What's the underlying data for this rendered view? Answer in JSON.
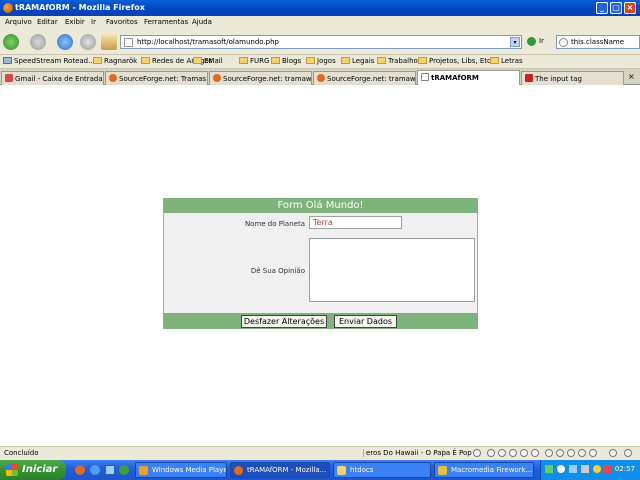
{
  "window": {
    "title": "tRAMAfORM - Mozilla Firefox",
    "controls": {
      "minimize": "_",
      "maximize": "□",
      "close": "×"
    }
  },
  "menu": [
    "Arquivo",
    "Editar",
    "Exibir",
    "Ir",
    "Favoritos",
    "Ferramentas",
    "Ajuda"
  ],
  "navbar": {
    "url": "http://localhost/tramasoft/olamundo.php",
    "go_label": "Ir",
    "search_value": "this.className",
    "dropdown_glyph": "▾"
  },
  "bookmarks": [
    "SpeedStream Rotead...",
    "Ragnarök",
    "Redes de Amigos",
    "EMail",
    "FURG",
    "Blogs",
    "Jogos",
    "Legais",
    "Trabalho",
    "Projetos, Libs, Etc",
    "Letras"
  ],
  "tabs": [
    {
      "label": "Gmail - Caixa de Entrada",
      "icon": "gmail-icon"
    },
    {
      "label": "SourceForge.net: Tramas...",
      "icon": "firefox-icon"
    },
    {
      "label": "SourceForge.net: tramaw...",
      "icon": "firefox-icon"
    },
    {
      "label": "SourceForge.net: tramaw...",
      "icon": "firefox-icon"
    },
    {
      "label": "tRAMAfORM",
      "icon": "page-icon",
      "active": true
    },
    {
      "label": "The input tag",
      "icon": "w3-icon"
    }
  ],
  "form": {
    "title": "Form Olá Mundo!",
    "planet_label": "Nome do Planeta",
    "planet_value": "Terra",
    "opinion_label": "Dê Sua Opinião",
    "opinion_value": "",
    "reset_label": "Desfazer Alterações",
    "submit_label": "Enviar Dados"
  },
  "status": {
    "text": "Concluído",
    "now_playing": "eros Do Hawaii - O Papa É Pop"
  },
  "taskbar": {
    "start_label": "Iniciar",
    "tasks": [
      {
        "label": "Windows Media Player",
        "icon": "media-player-icon"
      },
      {
        "label": "tRAMAfORM - Mozilla...",
        "icon": "firefox-icon",
        "active": true
      },
      {
        "label": "htdocs",
        "icon": "folder-icon"
      },
      {
        "label": "Macromedia Firework...",
        "icon": "fireworks-icon"
      }
    ],
    "clock": "02:57"
  },
  "colors": {
    "form_header": "#7eb37e",
    "titlebar": "#0348c2",
    "taskbar": "#245edb",
    "start_button": "#369234"
  }
}
